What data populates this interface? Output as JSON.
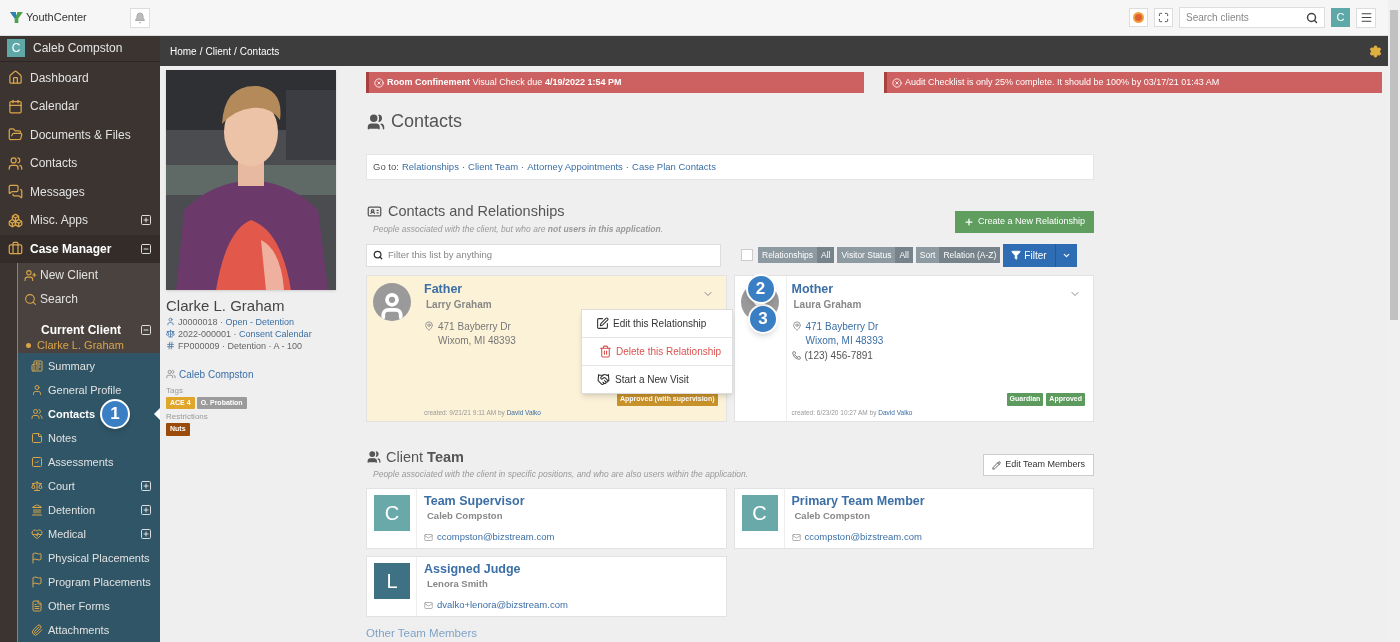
{
  "app": {
    "name": "YouthCenter"
  },
  "topbar": {
    "search_placeholder": "Search clients",
    "avatar": "C"
  },
  "sidebar": {
    "user": {
      "initial": "C",
      "name": "Caleb Compston"
    },
    "items": [
      {
        "label": "Dashboard",
        "selected": false
      },
      {
        "label": "Calendar",
        "selected": false
      },
      {
        "label": "Documents & Files",
        "selected": false
      },
      {
        "label": "Contacts",
        "selected": false
      },
      {
        "label": "Messages",
        "selected": false
      },
      {
        "label": "Misc. Apps",
        "selected": false,
        "expanded": false
      },
      {
        "label": "Case Manager",
        "selected": true,
        "expanded": true,
        "children": [
          {
            "label": "New Client"
          },
          {
            "label": "Search"
          },
          {
            "label": "Current Client",
            "subtitle": "Clarke L. Graham",
            "expanded": true,
            "children": [
              {
                "label": "Summary",
                "selected": false
              },
              {
                "label": "General Profile",
                "selected": false
              },
              {
                "label": "Contacts",
                "selected": true,
                "marker": "1"
              },
              {
                "label": "Notes",
                "selected": false
              },
              {
                "label": "Assessments",
                "selected": false
              },
              {
                "label": "Court",
                "selected": false,
                "expanded": false
              },
              {
                "label": "Detention",
                "selected": false,
                "expanded": false
              },
              {
                "label": "Medical",
                "selected": false,
                "expanded": false
              },
              {
                "label": "Physical Placements",
                "selected": false
              },
              {
                "label": "Program Placements",
                "selected": false
              },
              {
                "label": "Other Forms",
                "selected": false
              },
              {
                "label": "Attachments",
                "selected": false
              }
            ]
          }
        ]
      }
    ]
  },
  "breadcrumb": {
    "items": [
      "Home",
      "Client",
      "Contacts"
    ],
    "separator": "/"
  },
  "profile": {
    "name": "Clarke L. Graham",
    "lines": [
      {
        "code": "J0000018 ·",
        "link": "Open - Detention"
      },
      {
        "code": "2022-000001 ·",
        "link": "Consent Calendar"
      },
      {
        "code": "FP000009 · Detention · A - 100"
      }
    ],
    "worker": "Caleb Compston",
    "tags_label": "Tags",
    "tags": [
      {
        "text": "ACE 4",
        "color": "#e0a62a"
      },
      {
        "text": "O. Probation",
        "color": "#9b9b9b"
      }
    ],
    "restrictions_label": "Restrictions",
    "restrictions": [
      {
        "text": "Nuts",
        "color": "#9a4b0c"
      }
    ]
  },
  "alerts": [
    {
      "text": "**Room Confinement** Visual Check due **4/19/2022 1:54 PM**"
    },
    {
      "text": "Audit Checklist is only 25% complete. It should be 100% by 03/17/21 01:43 AM"
    }
  ],
  "page_title": "Contacts",
  "goto": {
    "label": "Go to:",
    "links": [
      "Relationships",
      "Client Team",
      "Attorney Appointments",
      "Case Plan Contacts"
    ],
    "separator": "·"
  },
  "relationships": {
    "title": "Contacts and Relationships",
    "subtitle": "People associated with the client, but who are **not users in this application**.",
    "create_button": "Create a New Relationship",
    "filter_placeholder": "Filter this list by anything",
    "select_all": false,
    "chips": [
      {
        "label": "Relationships",
        "value": "All"
      },
      {
        "label": "Visitor Status",
        "value": "All"
      },
      {
        "label": "Sort",
        "value": "Relation (A-Z)"
      }
    ],
    "filter_button": "Filter",
    "cards": [
      {
        "relation": "Father",
        "name": "Larry Graham",
        "address": [
          "471 Bayberry Dr",
          "Wixom, MI 48393"
        ],
        "address_link": false,
        "highlighted": true,
        "marker": "2",
        "badges": [
          {
            "text": "Approved (with supervision)",
            "color": "#c8922a"
          }
        ],
        "created": "created: 9/21/21 9:11 AM by",
        "creator": "David Valko",
        "menu": [
          {
            "kind": "edit",
            "label": "Edit this Relationship",
            "marker": "3"
          },
          {
            "kind": "delete",
            "label": "Delete this Relationship"
          },
          {
            "kind": "visit",
            "label": "Start a New Visit"
          }
        ]
      },
      {
        "relation": "Mother",
        "name": "Laura Graham",
        "address": [
          "471 Bayberry Dr",
          "Wixom, MI 48393"
        ],
        "address_link": true,
        "phone": "(123) 456-7891",
        "highlighted": false,
        "badges": [
          {
            "text": "Guardian",
            "color": "#5d9a5d"
          },
          {
            "text": "Approved",
            "color": "#5d9a5d"
          }
        ],
        "created": "created: 6/23/20 10:27 AM by",
        "creator": "David Valko"
      }
    ]
  },
  "team": {
    "title": "Client **Team**",
    "subtitle": "People associated with the client in specific positions, and who are also users within the application.",
    "edit_button": "Edit Team Members",
    "members": [
      {
        "role": "Team Supervisor",
        "name": "Caleb Compston",
        "email": "ccompston@bizstream.com",
        "initial": "C",
        "color": "#6aa9a9"
      },
      {
        "role": "Primary Team Member",
        "name": "Caleb Compston",
        "email": "ccompston@bizstream.com",
        "initial": "C",
        "color": "#6aa9a9"
      },
      {
        "role": "Assigned Judge",
        "name": "Lenora Smith",
        "email": "dvalko+lenora@bizstream.com",
        "initial": "L",
        "color": "#3e7184"
      }
    ],
    "other_heading": "Other Team Members"
  }
}
